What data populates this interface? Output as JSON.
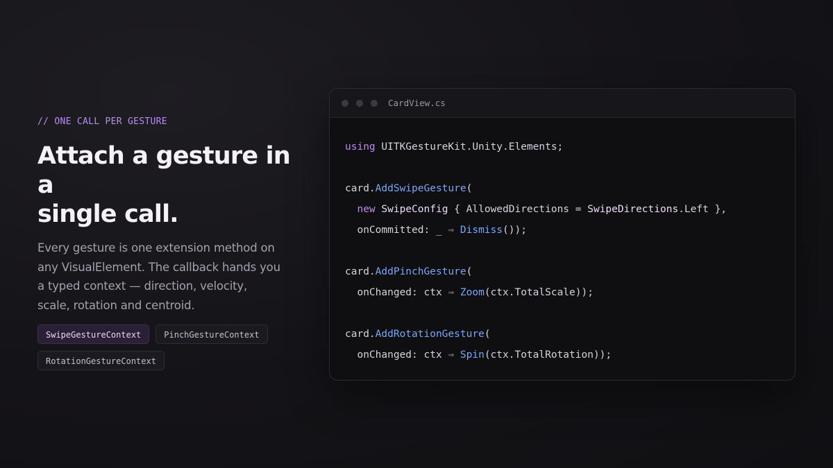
{
  "eyebrow": "// ONE CALL PER GESTURE",
  "headline": {
    "line1": "Attach a gesture in a",
    "line2": "single call."
  },
  "description": {
    "line1": "Every gesture is one extension method on",
    "line2": "any VisualElement. The callback hands you",
    "line3": "a typed context — direction, velocity,",
    "line4": "scale, rotation and centroid."
  },
  "chips": [
    {
      "label": "SwipeGestureContext",
      "active": true
    },
    {
      "label": "PinchGestureContext",
      "active": false
    },
    {
      "label": "RotationGestureContext",
      "active": false
    }
  ],
  "editor": {
    "filename": "CardView.cs",
    "code": {
      "l1_kw": "using",
      "l1_rest": " UITKGestureKit.Unity.Elements;",
      "l3_obj": "card.",
      "l3_fn": "AddSwipeGesture",
      "l3_end": "(",
      "l4_kw": "new",
      "l4_type": "SwipeConfig",
      "l4_mid": " { AllowedDirections = ",
      "l4_enum": "SwipeDirections",
      "l4_end": ".Left },",
      "l5_start": "onCommitted: _ ",
      "l5_arrow": "⇒",
      "l5_fn": "Dismiss",
      "l5_end": "());",
      "l7_obj": "card.",
      "l7_fn": "AddPinchGesture",
      "l7_end": "(",
      "l8_start": "onChanged: ctx ",
      "l8_arrow": "⇒",
      "l8_fn": "Zoom",
      "l8_end": "(ctx.TotalScale));",
      "l10_obj": "card.",
      "l10_fn": "AddRotationGesture",
      "l10_end": "(",
      "l11_start": "onChanged: ctx ",
      "l11_arrow": "⇒",
      "l11_fn": "Spin",
      "l11_end": "(ctx.TotalRotation));"
    }
  },
  "colors": {
    "accent": "#b98cf0",
    "keyword": "#c08af2",
    "function": "#7aa6f5",
    "background": "#141317"
  }
}
